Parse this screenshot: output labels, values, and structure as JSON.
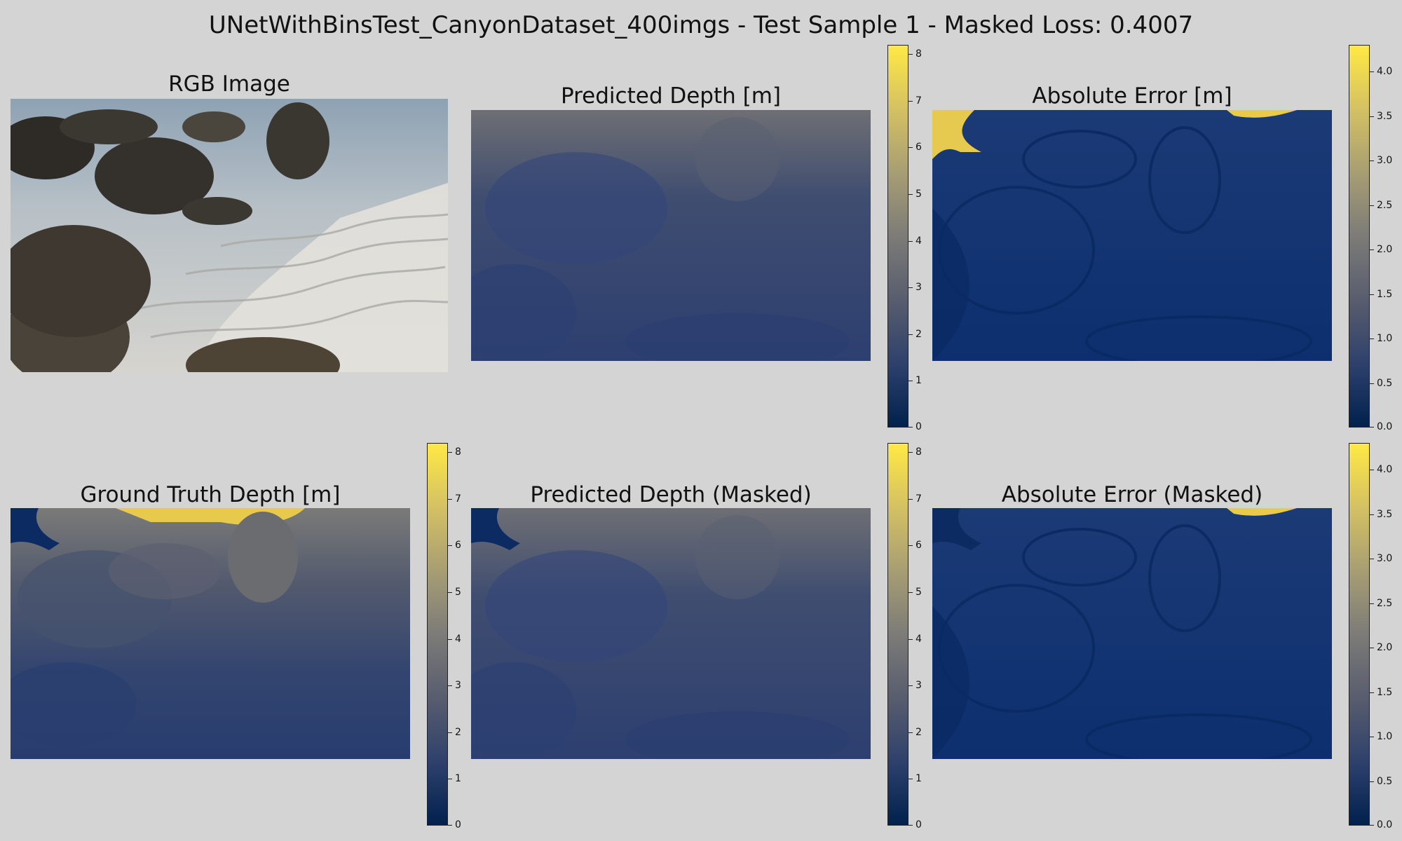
{
  "title": "UNetWithBinsTest_CanyonDataset_400imgs - Test Sample 1 - Masked Loss: 0.4007",
  "panels": [
    {
      "title": "RGB Image"
    },
    {
      "title": "Predicted Depth [m]"
    },
    {
      "title": "Absolute Error [m]"
    },
    {
      "title": "Ground Truth Depth [m]"
    },
    {
      "title": "Predicted Depth (Masked)"
    },
    {
      "title": "Absolute Error (Masked)"
    }
  ],
  "colormap": {
    "name": "cividis",
    "colors": [
      "#00204c",
      "#2c3f6b",
      "#575c6e",
      "#7c7b78",
      "#a59c74",
      "#d3c064",
      "#ffe945"
    ]
  },
  "chart_data": [
    {
      "type": "heatmap",
      "title": "Predicted Depth [m]",
      "colorbar": {
        "range": [
          0,
          8.2
        ],
        "ticks": [
          "0",
          "1",
          "2",
          "3",
          "4",
          "5",
          "6",
          "7",
          "8"
        ]
      }
    },
    {
      "type": "heatmap",
      "title": "Absolute Error [m]",
      "colorbar": {
        "range": [
          0,
          4.3
        ],
        "ticks": [
          "0.0",
          "0.5",
          "1.0",
          "1.5",
          "2.0",
          "2.5",
          "3.0",
          "3.5",
          "4.0"
        ]
      }
    },
    {
      "type": "heatmap",
      "title": "Ground Truth Depth [m]",
      "colorbar": {
        "range": [
          0,
          8.2
        ],
        "ticks": [
          "0",
          "1",
          "2",
          "3",
          "4",
          "5",
          "6",
          "7",
          "8"
        ]
      }
    },
    {
      "type": "heatmap",
      "title": "Predicted Depth (Masked)",
      "colorbar": {
        "range": [
          0,
          8.2
        ],
        "ticks": [
          "0",
          "1",
          "2",
          "3",
          "4",
          "5",
          "6",
          "7",
          "8"
        ]
      }
    },
    {
      "type": "heatmap",
      "title": "Absolute Error (Masked)",
      "colorbar": {
        "range": [
          0,
          4.3
        ],
        "ticks": [
          "0.0",
          "0.5",
          "1.0",
          "1.5",
          "2.0",
          "2.5",
          "3.0",
          "3.5",
          "4.0"
        ]
      }
    }
  ]
}
